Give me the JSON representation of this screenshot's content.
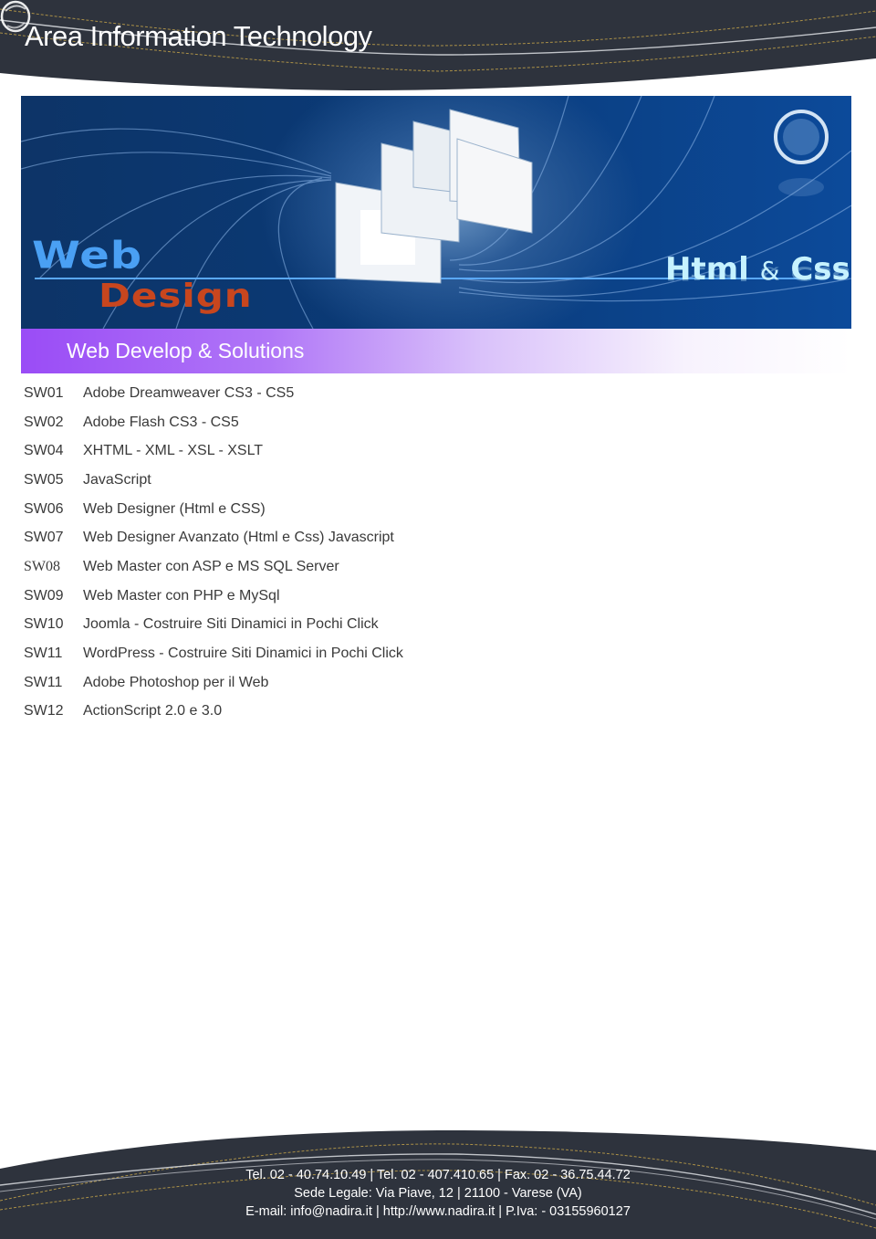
{
  "header": {
    "title": "Area Information Technology",
    "globe_icon": "glass-globe-icon"
  },
  "banner": {
    "web_word": "Web",
    "design_word": "Design",
    "html_word": "Html",
    "amp": "&",
    "css_word": "Css",
    "colors": {
      "web": "#4aa0f4",
      "design": "#c8461e",
      "html_css": "#c6f2ff",
      "background": "#0a3a77"
    }
  },
  "section": {
    "title": "Web Develop & Solutions",
    "color": "#9a4cf6"
  },
  "courses": [
    {
      "code": "SW01",
      "name": "Adobe Dreamweaver CS3 - CS5"
    },
    {
      "code": "SW02",
      "name": "Adobe Flash CS3 - CS5"
    },
    {
      "code": "SW04",
      "name": "XHTML - XML - XSL - XSLT"
    },
    {
      "code": "SW05",
      "name": "JavaScript"
    },
    {
      "code": "SW06",
      "name": "Web Designer (Html e CSS)"
    },
    {
      "code": "SW07",
      "name": "Web Designer Avanzato (Html e Css) Javascript"
    },
    {
      "code": "SW08",
      "name": "Web Master con ASP e MS SQL Server"
    },
    {
      "code": "SW09",
      "name": "Web Master con PHP e MySql"
    },
    {
      "code": "SW10",
      "name": "Joomla - Costruire Siti Dinamici in Pochi Click"
    },
    {
      "code": "SW11",
      "name": "WordPress - Costruire Siti Dinamici in Pochi Click"
    },
    {
      "code": "SW11",
      "name": "Adobe Photoshop per il Web"
    },
    {
      "code": "SW12",
      "name": "ActionScript 2.0 e 3.0"
    }
  ],
  "footer": {
    "line1": "Tel. 02 - 40.74.10.49 | Tel. 02 - 407.410.65 | Fax. 02 - 36.75.44.72",
    "line2": "Sede Legale: Via Piave, 12 | 21100 - Varese (VA)",
    "line3": "E-mail: info@nadira.it | http://www.nadira.it | P.Iva: - 03155960127",
    "background": "#2e333d"
  }
}
